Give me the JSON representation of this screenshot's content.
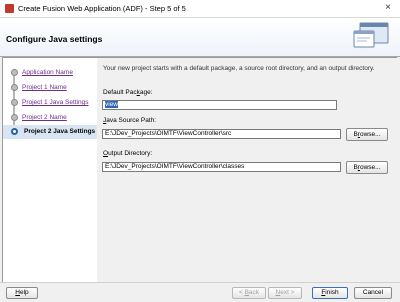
{
  "window": {
    "title": "Create Fusion Web Application (ADF) - Step 5 of 5",
    "close_glyph": "×",
    "icon": "app-icon"
  },
  "banner": {
    "title": "Configure Java settings"
  },
  "steps": [
    {
      "label": "Application Name",
      "state": "done"
    },
    {
      "label": "Project 1 Name",
      "state": "done"
    },
    {
      "label": "Project 1 Java Settings",
      "state": "done"
    },
    {
      "label": "Project 2 Name",
      "state": "done"
    },
    {
      "label": "Project 2 Java Settings",
      "state": "current"
    }
  ],
  "main": {
    "intro": "Your new project starts with a default package, a source root directory, and an output directory.",
    "default_package": {
      "label_pre": "Default Pac",
      "label_u": "k",
      "label_post": "age:",
      "value": "view"
    },
    "java_source_path": {
      "label_pre": "",
      "label_u": "J",
      "label_post": "ava Source Path:",
      "value": "E:\\JDev_Projects\\OIMTF\\ViewController\\src"
    },
    "output_directory": {
      "label_pre": "",
      "label_u": "O",
      "label_post": "utput Directory:",
      "value": "E:\\JDev_Projects\\OIMTF\\ViewController\\classes"
    },
    "browse_pre": "B",
    "browse_u": "r",
    "browse_post": "owse..."
  },
  "footer": {
    "help": {
      "u": "H",
      "rest": "elp"
    },
    "back": {
      "pre": "< ",
      "u": "B",
      "rest": "ack"
    },
    "next": {
      "u": "N",
      "rest": "ext >"
    },
    "finish": {
      "u": "F",
      "rest": "inish"
    },
    "cancel": "Cancel"
  }
}
